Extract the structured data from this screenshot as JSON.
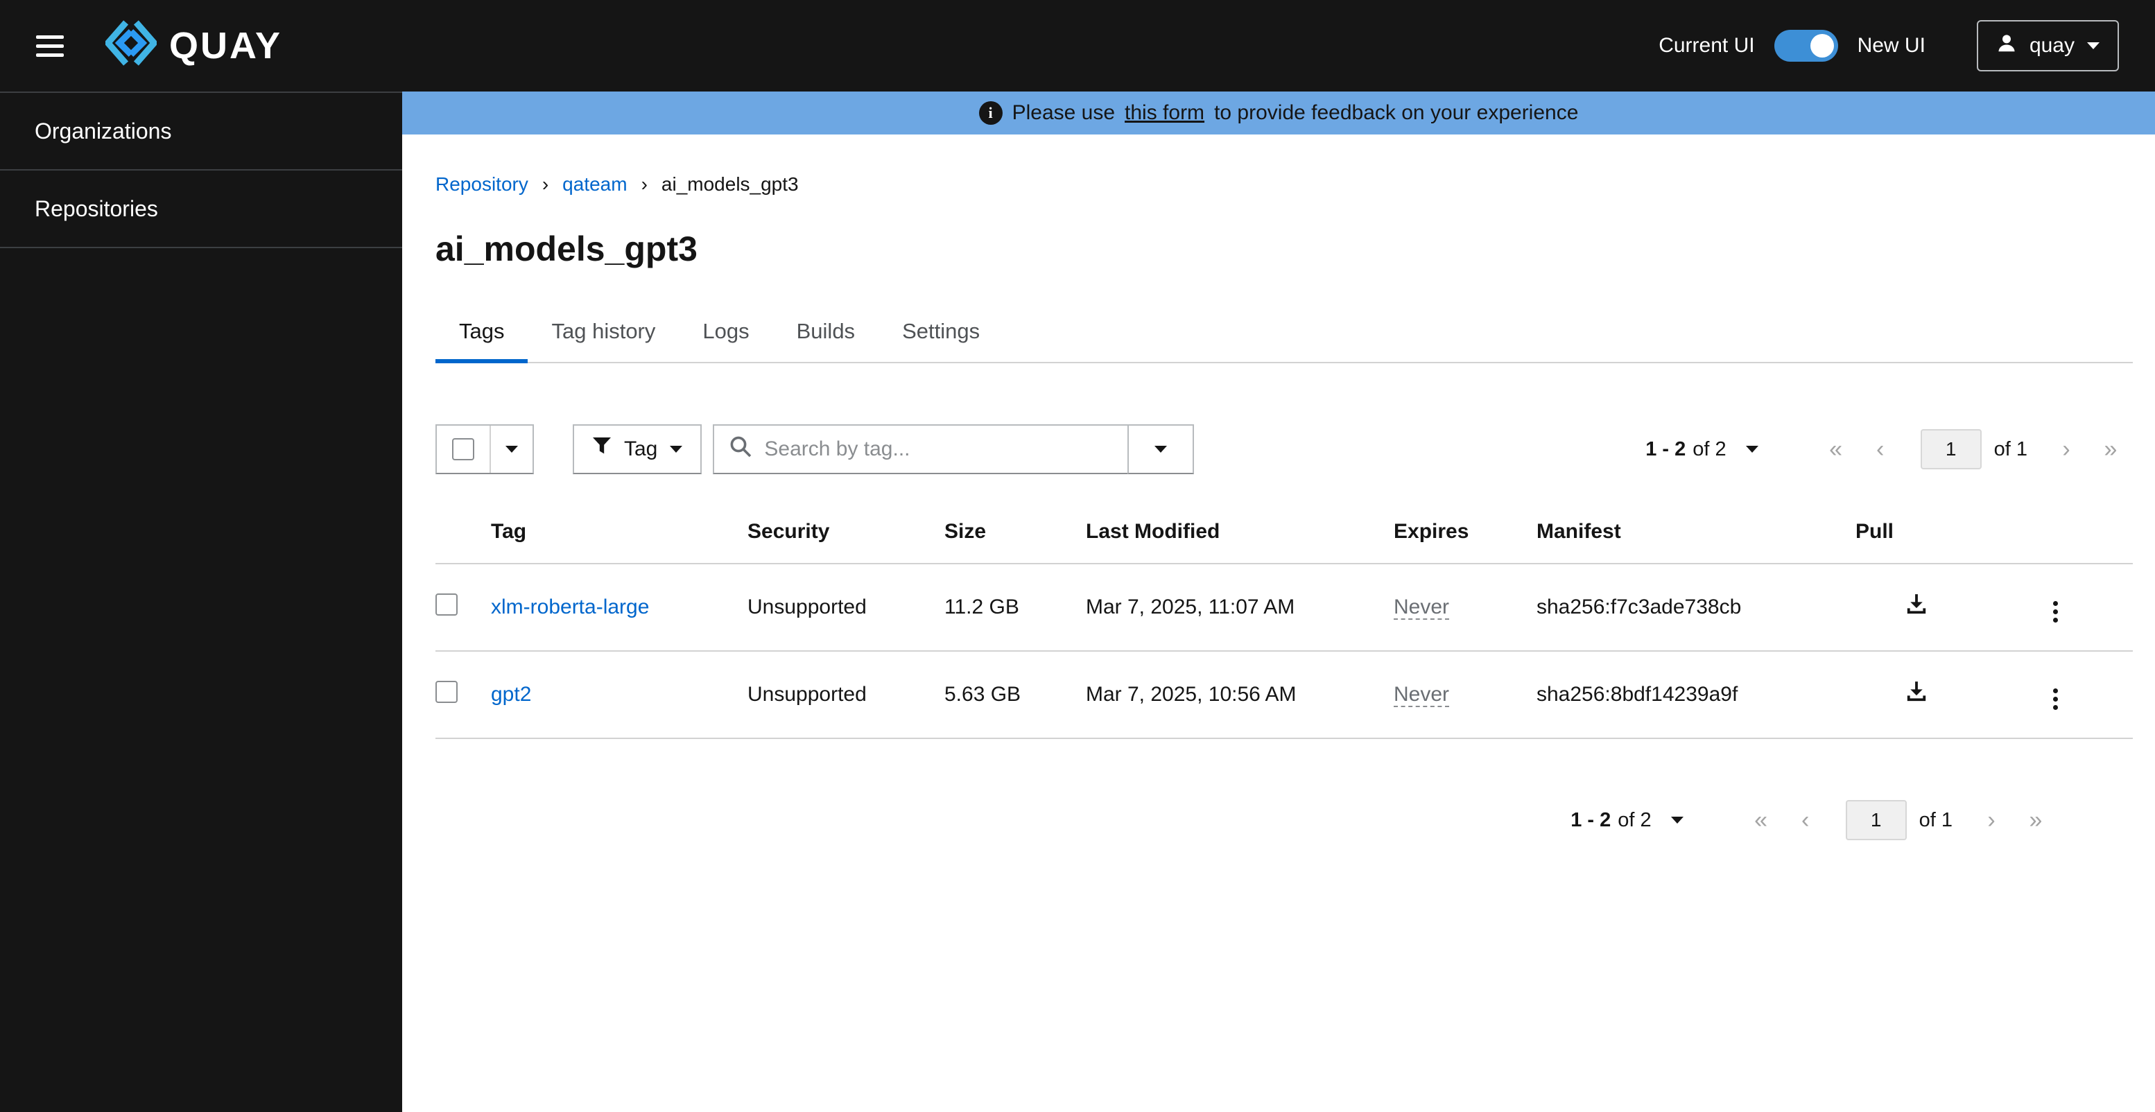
{
  "header": {
    "brand": "QUAY",
    "current_ui_label": "Current UI",
    "new_ui_label": "New UI",
    "user_name": "quay"
  },
  "sidebar": {
    "items": [
      {
        "label": "Organizations"
      },
      {
        "label": "Repositories"
      }
    ]
  },
  "banner": {
    "prefix": "Please use",
    "link": "this form",
    "suffix": "to provide feedback on your experience"
  },
  "breadcrumb": {
    "items": [
      "Repository",
      "qateam",
      "ai_models_gpt3"
    ]
  },
  "page": {
    "title": "ai_models_gpt3"
  },
  "tabs": [
    {
      "label": "Tags"
    },
    {
      "label": "Tag history"
    },
    {
      "label": "Logs"
    },
    {
      "label": "Builds"
    },
    {
      "label": "Settings"
    }
  ],
  "toolbar": {
    "filter_label": "Tag",
    "search_placeholder": "Search by tag..."
  },
  "pagination_top": {
    "range_strong": "1 - 2",
    "range_rest": "of 2",
    "page": "1",
    "of_label": "of 1"
  },
  "pagination_bottom": {
    "range_strong": "1 - 2",
    "range_rest": "of 2",
    "page": "1",
    "of_label": "of 1"
  },
  "table": {
    "headers": {
      "tag": "Tag",
      "security": "Security",
      "size": "Size",
      "last_modified": "Last Modified",
      "expires": "Expires",
      "manifest": "Manifest",
      "pull": "Pull"
    },
    "rows": [
      {
        "tag": "xlm-roberta-large",
        "security": "Unsupported",
        "size": "11.2 GB",
        "last_modified": "Mar 7, 2025, 11:07 AM",
        "expires": "Never",
        "manifest": "sha256:f7c3ade738cb"
      },
      {
        "tag": "gpt2",
        "security": "Unsupported",
        "size": "5.63 GB",
        "last_modified": "Mar 7, 2025, 10:56 AM",
        "expires": "Never",
        "manifest": "sha256:8bdf14239a9f"
      }
    ]
  },
  "colors": {
    "accent": "#0066cc",
    "banner_bg": "#6da7e3",
    "header_bg": "#151515"
  }
}
